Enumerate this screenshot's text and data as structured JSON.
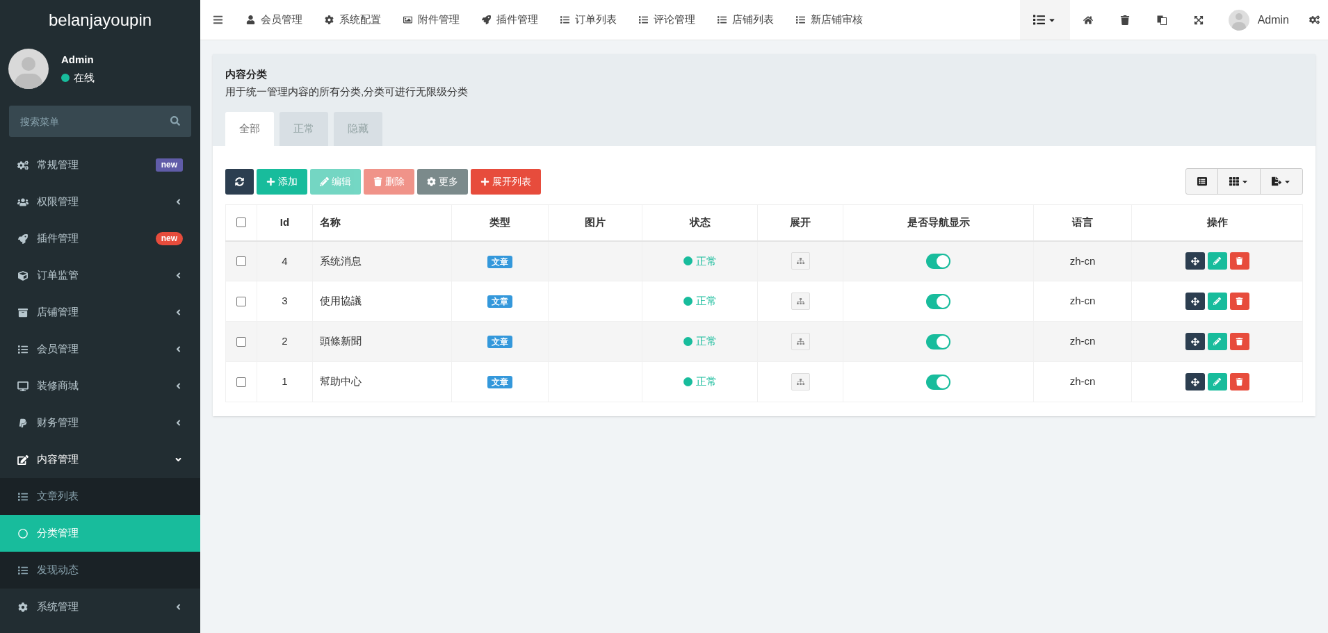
{
  "sidebar": {
    "logo": "belanjayoupin",
    "user": {
      "name": "Admin",
      "status": "在线"
    },
    "search": {
      "placeholder": "搜索菜单"
    },
    "items": [
      {
        "label": "常规管理",
        "badge": {
          "text": "new",
          "color": "#605ca8"
        }
      },
      {
        "label": "权限管理",
        "expanded": false
      },
      {
        "label": "插件管理",
        "badge": {
          "text": "new",
          "color": "#e74c3c"
        }
      },
      {
        "label": "订单监管",
        "expanded": false
      },
      {
        "label": "店铺管理",
        "expanded": false
      },
      {
        "label": "会员管理",
        "expanded": false
      },
      {
        "label": "装修商城",
        "expanded": false
      },
      {
        "label": "财务管理",
        "expanded": false
      },
      {
        "label": "内容管理",
        "expanded": true,
        "children": [
          {
            "label": "文章列表",
            "selected": false
          },
          {
            "label": "分类管理",
            "selected": true
          },
          {
            "label": "发现动态",
            "selected": false
          }
        ]
      },
      {
        "label": "系统管理",
        "expanded": false
      }
    ]
  },
  "top_nav": {
    "items": [
      {
        "label": "会员管理"
      },
      {
        "label": "系统配置"
      },
      {
        "label": "附件管理"
      },
      {
        "label": "插件管理"
      },
      {
        "label": "订单列表"
      },
      {
        "label": "评论管理"
      },
      {
        "label": "店铺列表"
      },
      {
        "label": "新店铺审核"
      }
    ],
    "user": "Admin"
  },
  "panel": {
    "title": "内容分类",
    "description": "用于统一管理内容的所有分类,分类可进行无限级分类",
    "tabs": [
      {
        "label": "全部",
        "selected": true
      },
      {
        "label": "正常",
        "selected": false
      },
      {
        "label": "隐藏",
        "selected": false
      }
    ],
    "toolbar": [
      {
        "kind": "refresh",
        "disabled": false
      },
      {
        "kind": "add",
        "label": "添加",
        "disabled": false
      },
      {
        "kind": "edit",
        "label": "编辑",
        "disabled": true
      },
      {
        "kind": "delete",
        "label": "删除",
        "disabled": true
      },
      {
        "kind": "more",
        "label": "更多",
        "disabled": false
      },
      {
        "kind": "expand",
        "label": "展开列表",
        "disabled": false
      }
    ],
    "table": {
      "select_all": {
        "checked": false
      },
      "columns": [
        "Id",
        "名称",
        "类型",
        "图片",
        "状态",
        "展开",
        "是否导航显示",
        "语言",
        "操作"
      ],
      "rows": [
        {
          "checked": false,
          "id": "4",
          "name": "系统消息",
          "type": "文章",
          "status": "正常",
          "nav_shown": true,
          "language": "zh-cn"
        },
        {
          "checked": false,
          "id": "3",
          "name": "使用協議",
          "type": "文章",
          "status": "正常",
          "nav_shown": true,
          "language": "zh-cn"
        },
        {
          "checked": false,
          "id": "2",
          "name": "頭條新聞",
          "type": "文章",
          "status": "正常",
          "nav_shown": true,
          "language": "zh-cn"
        },
        {
          "checked": false,
          "id": "1",
          "name": "幫助中心",
          "type": "文章",
          "status": "正常",
          "nav_shown": true,
          "language": "zh-cn"
        }
      ]
    }
  }
}
